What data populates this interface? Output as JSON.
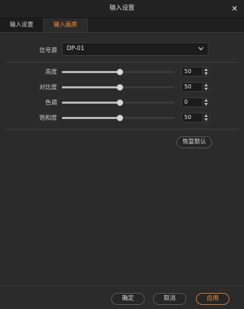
{
  "window": {
    "title": "输入设置",
    "close_icon": "close-icon"
  },
  "tabs": [
    {
      "label": "输入设置",
      "active": false
    },
    {
      "label": "输入画质",
      "active": true
    }
  ],
  "signal_source": {
    "label": "信号源",
    "value": "DP-01"
  },
  "adjustments": [
    {
      "label": "亮度",
      "value": "50",
      "level_percent": 50
    },
    {
      "label": "对比度",
      "value": "50",
      "level_percent": 50
    },
    {
      "label": "色调",
      "value": "0",
      "level_percent": 50
    },
    {
      "label": "饱和度",
      "value": "50",
      "level_percent": 50
    }
  ],
  "buttons": {
    "restore_default": "恢复默认",
    "ok": "确定",
    "cancel": "取消",
    "apply": "应用"
  },
  "colors": {
    "accent": "#ff8a2a",
    "background": "#2b2b2b"
  }
}
